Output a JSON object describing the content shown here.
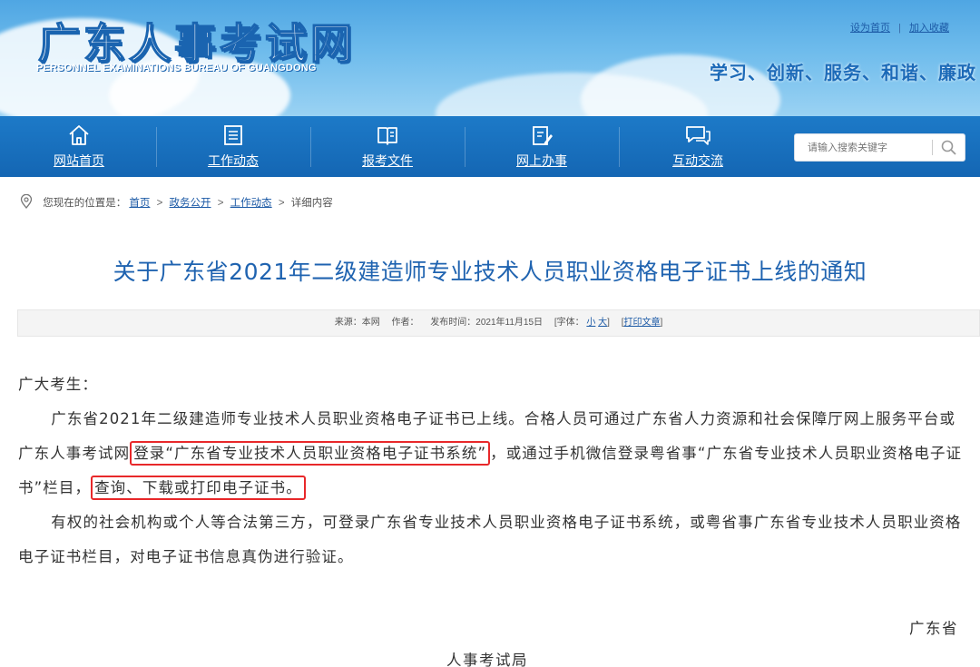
{
  "header": {
    "logo_title": "广东人事考试网",
    "logo_subtitle": "PERSONNEL EXAMINATIONS BUREAU OF GUANGDONG",
    "top_links": [
      "设为首页",
      "加入收藏"
    ],
    "slogan": "学习、创新、服务、和谐、廉政"
  },
  "nav": {
    "items": [
      {
        "label": "网站首页",
        "icon": "home-icon"
      },
      {
        "label": "工作动态",
        "icon": "news-icon"
      },
      {
        "label": "报考文件",
        "icon": "document-icon"
      },
      {
        "label": "网上办事",
        "icon": "clipboard-edit-icon"
      },
      {
        "label": "互动交流",
        "icon": "chat-icon"
      }
    ],
    "search_placeholder": "请输入搜索关键字"
  },
  "breadcrumb": {
    "prefix": "您现在的位置是：",
    "items": [
      "首页",
      "政务公开",
      "工作动态"
    ],
    "current": "详细内容"
  },
  "article": {
    "title": "关于广东省2021年二级建造师专业技术人员职业资格电子证书上线的通知",
    "meta": {
      "source": "来源：本网",
      "author": "作者：",
      "published": "发布时间：2021年11月15日",
      "font_label": "[字体：",
      "font_small": "小",
      "font_large": "大",
      "font_close": "]",
      "print_open": "[",
      "print": "打印文章",
      "print_close": "]"
    },
    "greeting": "广大考生：",
    "para1_a": "广东省2021年二级建造师专业技术人员职业资格电子证书已上线。合格人员可通过广东省人力资源和社会保障厅网上服务平台或广东人事考试网",
    "para1_hl1": "登录“广东省专业技术人员职业资格电子证书系统”",
    "para1_b": "，或通过手机微信登录粤省事“广东省专业技术人员职业资格电子证书”栏目，",
    "para1_hl2": "查询、下载或打印电子证书。",
    "para2": "有权的社会机构或个人等合法第三方，可登录广东省专业技术人员职业资格电子证书系统，或粤省事广东省专业技术人员职业资格电子证书栏目，对电子证书信息真伪进行验证。",
    "sign_line1": "广东省",
    "sign_line2": "人事考试局"
  },
  "colors": {
    "nav_bg": "#1466b3",
    "title_blue": "#1f63b0",
    "highlight_red": "#e8282a"
  }
}
